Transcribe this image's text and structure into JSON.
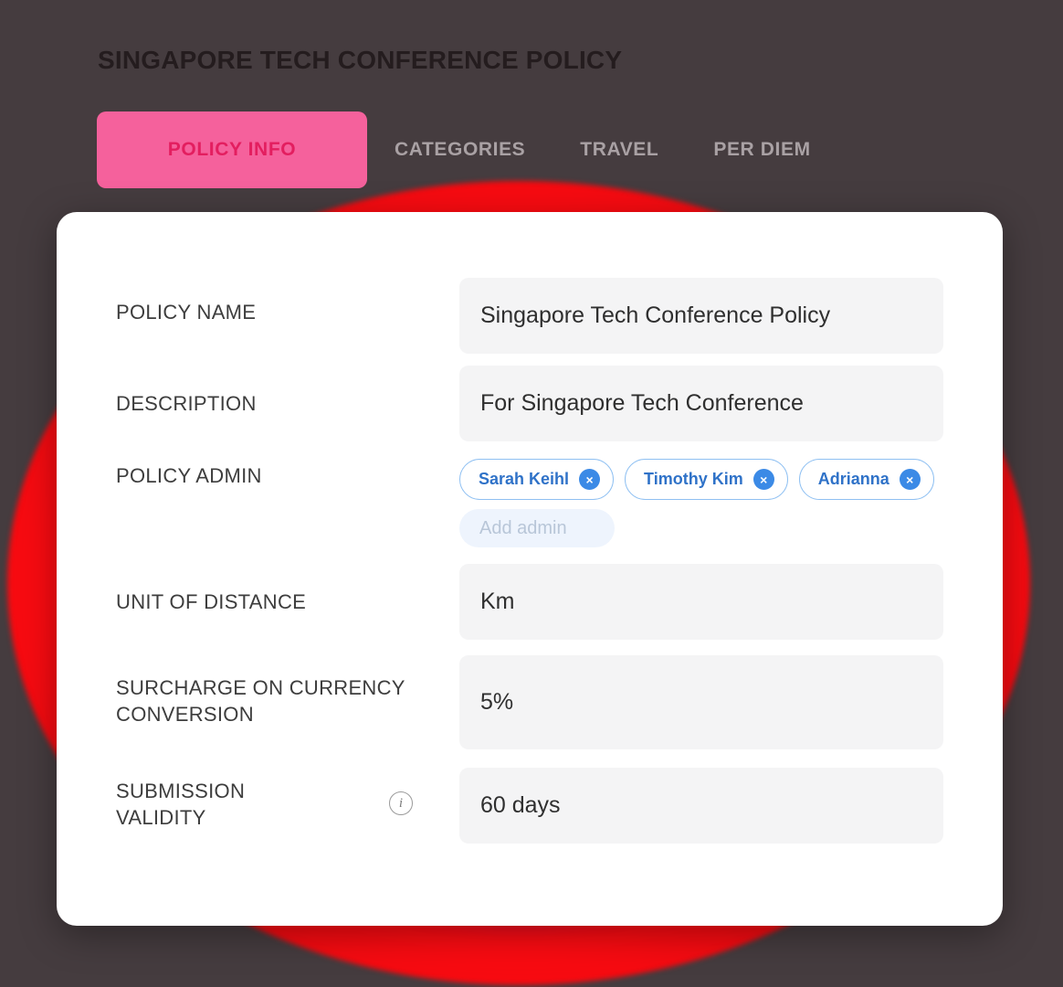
{
  "page": {
    "title": "SINGAPORE TECH CONFERENCE POLICY",
    "background_color": "#453c3f",
    "title_color": "#241c1e"
  },
  "tabs": {
    "active_index": 0,
    "active_bg": "#f5619c",
    "active_text_color": "#e31e5f",
    "inactive_text_color": "#a9a1a4",
    "items": [
      {
        "label": "POLICY INFO"
      },
      {
        "label": "CATEGORIES"
      },
      {
        "label": "TRAVEL"
      },
      {
        "label": "PER DIEM"
      }
    ]
  },
  "card": {
    "fields": [
      {
        "label": "POLICY NAME",
        "value": "Singapore Tech Conference Policy",
        "type": "text"
      },
      {
        "label": "DESCRIPTION",
        "value": "For Singapore Tech Conference",
        "type": "text"
      },
      {
        "label": "POLICY ADMIN",
        "type": "chips"
      },
      {
        "label": "UNIT OF DISTANCE",
        "value": "Km",
        "type": "text"
      },
      {
        "label": "SURCHARGE ON CURRENCY CONVERSION",
        "value": "5%",
        "type": "text"
      },
      {
        "label": "SUBMISSION VALIDITY",
        "value": "60 days",
        "type": "text",
        "info_icon": "info-icon",
        "info_glyph": "i"
      }
    ],
    "admins": [
      {
        "name": "Sarah Keihl",
        "remove_glyph": "×"
      },
      {
        "name": "Timothy Kim",
        "remove_glyph": "×"
      },
      {
        "name": "Adrianna",
        "remove_glyph": "×"
      }
    ],
    "add_admin_placeholder": "Add admin",
    "add_admin_value": "",
    "chip_border_color": "#8fc0f2",
    "chip_text_color": "#2f72c8",
    "chip_remove_color": "#3b8ae6",
    "field_bg": "#f4f4f5"
  },
  "decoration": {
    "name": "circular-glow",
    "colors": [
      "#0a0002",
      "#ff0c12",
      "#c01040",
      "#b8009d"
    ]
  }
}
